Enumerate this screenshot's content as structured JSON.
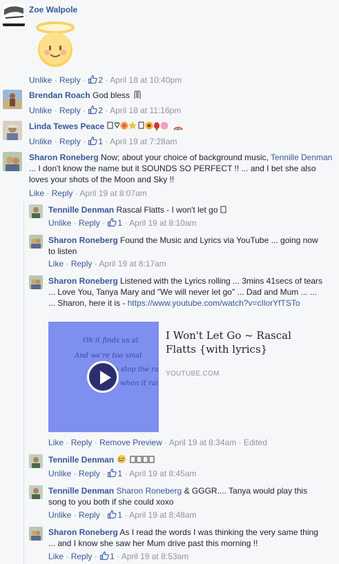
{
  "actions": {
    "like": "Like",
    "unlike": "Unlike",
    "reply": "Reply",
    "remove_preview": "Remove Preview",
    "edited": "Edited",
    "sep": "·"
  },
  "comments": [
    {
      "name": "Zoe Walpole",
      "text": "",
      "likes": "2",
      "time": "April 18 at 10:40pm"
    },
    {
      "name": "Brendan Roach",
      "text": "God bless",
      "likes": "2",
      "time": "April 18 at 11:16pm"
    },
    {
      "name": "Linda Tewes Peace",
      "text": "",
      "likes": "1",
      "time": "April 19 at 7:28am"
    },
    {
      "name": "Sharon Roneberg",
      "text_before": "Now; about your choice of background music,",
      "mention": "Tennille Denman",
      "text_after": "... I don't know the name but it SOUNDS SO PERFECT !! ... and I bet she also loves your shots of the Moon and Sky !!",
      "time": "April 19 at 8:07am"
    }
  ],
  "replies": [
    {
      "name": "Tennille Denman",
      "text": "Rascal Flatts - I won't let go",
      "likes": "1",
      "time": "April 19 at 8:10am"
    },
    {
      "name": "Sharon Roneberg",
      "text": "Found the Music and Lyrics via YouTube ... going now to listen",
      "time": "April 19 at 8:17am"
    },
    {
      "name": "Sharon Roneberg",
      "text": "Listened with the Lyrics rolling ... 3mins 41secs of tears ... Love You, Tanya Mary and \"We will never let go\" ... Dad and Mum ... ... ... Sharon, here it is -",
      "url": "https://www.youtube.com/watch?v=cIlorYfTSTo",
      "time": "April 19 at 8:34am"
    },
    {
      "name": "Tennille Denman",
      "text": "",
      "likes": "1",
      "time": "April 19 at 8:45am"
    },
    {
      "name": "Tennille Denman",
      "mention": "Sharon Roneberg",
      "text": "& GGGR.... Tanya would play this song to you both if she could xoxo",
      "likes": "1",
      "time": "April 19 at 8:48am"
    },
    {
      "name": "Sharon Roneberg",
      "text": "As I read the words I was thinking the very same thing ... and I know she saw her Mum drive past this morning !!",
      "likes": "1",
      "time": "April 19 at 8:53am"
    }
  ],
  "preview": {
    "title": "I Won't Let Go ~ Rascal Flatts {with lyrics}",
    "source": "YOUTUBE.COM",
    "lyrics": [
      "Oh it finds us al",
      "And we're too smal",
      "To stop the rai",
      "when it rai"
    ]
  },
  "colors": {
    "link": "#365899",
    "meta": "#90949c",
    "thumb": "#7e8ff0"
  },
  "icons": {
    "like": "thumbs-up-icon",
    "play": "play-icon"
  }
}
